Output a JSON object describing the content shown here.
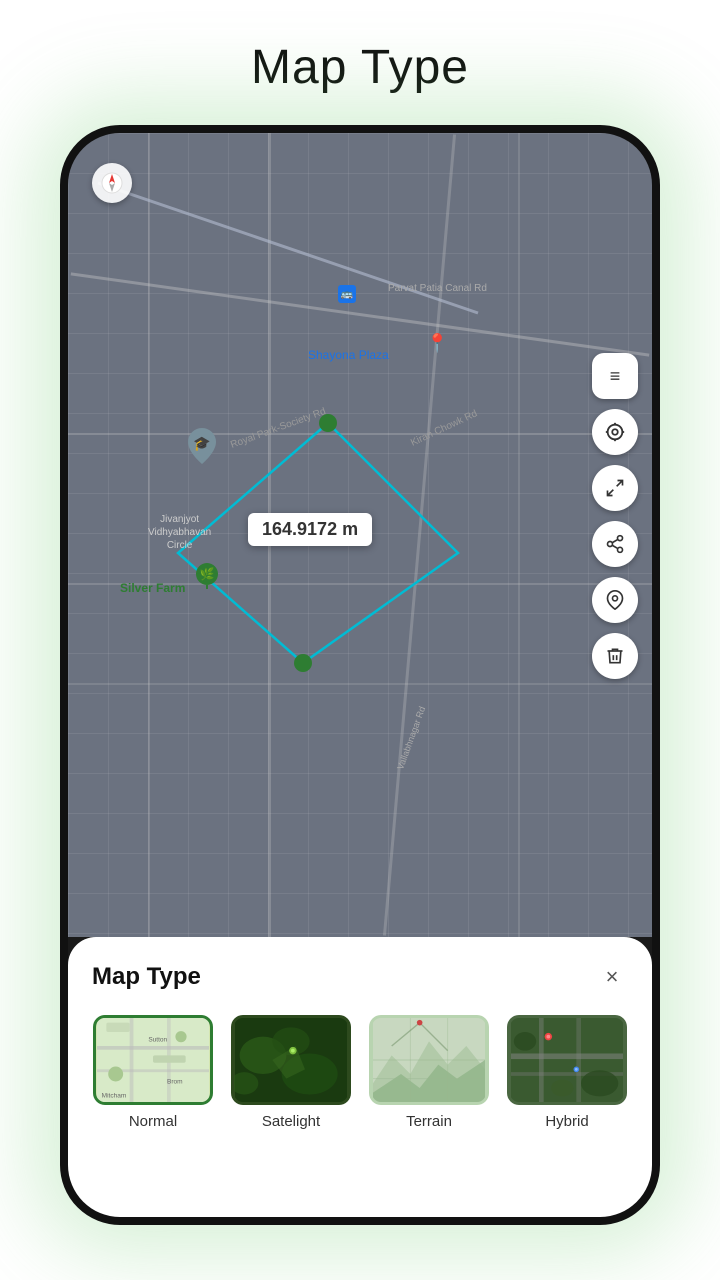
{
  "page": {
    "title": "Map Type"
  },
  "map": {
    "distance_label": "164.9172 m",
    "labels": {
      "shayona_plaza": "Shayona Plaza",
      "parvat_patia_canal_rd": "Parvat Patia Canal Rd",
      "royal_park_society_rd": "Royal Park-Society Rd",
      "kiran_chowk_rd": "Kiran Chowk Rd",
      "vallabhnagar_rd": "Vallabhnagar Rd",
      "jivanjyot": "Jivanjyot",
      "vidhyabhavan": "Vidhyabhavan",
      "circle": "Circle",
      "silver_farm": "Silver Farm"
    }
  },
  "toolbar": {
    "menu_icon": "≡",
    "location_icon": "⊕",
    "expand_icon": "⛶",
    "share_icon": "⋯",
    "pin_icon": "📍",
    "delete_icon": "🗑"
  },
  "bottom_sheet": {
    "title": "Map Type",
    "close_label": "×",
    "map_types": [
      {
        "id": "normal",
        "label": "Normal",
        "selected": true
      },
      {
        "id": "satelight",
        "label": "Satelight",
        "selected": false
      },
      {
        "id": "terrain",
        "label": "Terrain",
        "selected": false
      },
      {
        "id": "hybrid",
        "label": "Hybrid",
        "selected": false
      }
    ]
  }
}
